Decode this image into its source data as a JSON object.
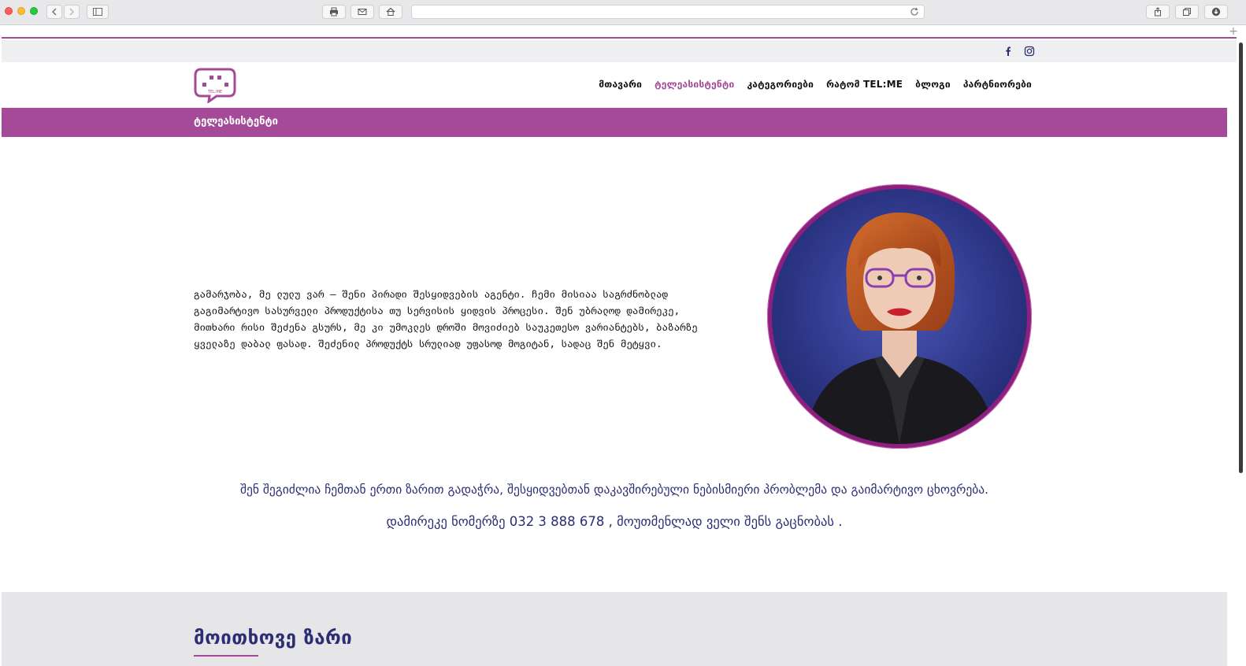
{
  "browser": {
    "icons": [
      "chevron-left-icon",
      "chevron-right-icon",
      "sidebar-icon",
      "print-icon",
      "mail-icon",
      "home-icon",
      "reload-icon",
      "share-icon",
      "tabs-icon",
      "download-icon"
    ]
  },
  "social": {
    "facebook_label": "f"
  },
  "logo": {
    "text": "TEL:ME"
  },
  "nav": {
    "items": [
      {
        "label": "მთავარი",
        "active": false
      },
      {
        "label": "ტელეასისტენტი",
        "active": true
      },
      {
        "label": "კატეგორიები",
        "active": false
      },
      {
        "label": "რატომ TEL:ME",
        "active": false
      },
      {
        "label": "ბლოგი",
        "active": false
      },
      {
        "label": "პარტნიორები",
        "active": false
      }
    ]
  },
  "page_title": "ტელეასისტენტი",
  "intro": {
    "lines": [
      "გამარჯობა, მე ლულუ ვარ – შენი პირადი შესყიდვების აგენტი. ჩემი მისიაა საგრძნობლად",
      "გაგიმარტივო სასურველი პროდუქტისა თუ სერვისის ყიდვის პროცესი. შენ უბრალოდ დამირეკე,",
      "მითხარი რისი შეძენა გსურს, მე კი უმოკლეს დროში მოვიძიებ საუკეთესო ვარიანტებს, ბაზარზე",
      "ყველაზე დაბალ ფასად. შეძენილ პროდუქტს სრულიად უფასოდ მოგიტან, სადაც შენ მეტყვი."
    ]
  },
  "cta": {
    "line1": "შენ შეგიძლია ჩემთან ერთი ზარით გადაჭრა, შესყიდვებთან დაკავშირებული ნებისმიერი პრობლემა და გაიმარტივო ცხოვრება.",
    "line2": "დამირეკე ნომერზე 032 3 888 678 , მოუთმენლად ველი შენს გაცნობას ."
  },
  "section": {
    "heading": "მოითხოვე ზარი"
  },
  "colors": {
    "accent": "#a44a98",
    "navy": "#2b2e73",
    "grey": "#e6e6e9"
  }
}
